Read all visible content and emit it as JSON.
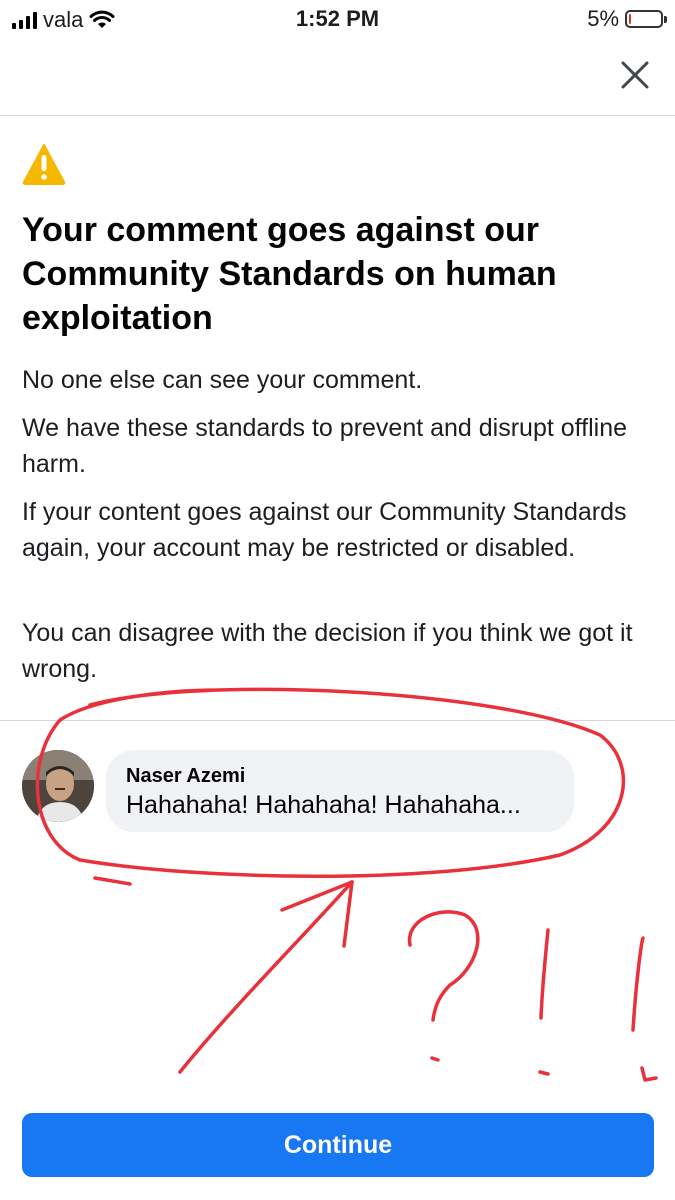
{
  "status_bar": {
    "carrier": "vala",
    "time": "1:52 PM",
    "battery_percent": "5%",
    "battery_level": 0.05,
    "icons": [
      "signal-icon",
      "wifi-icon",
      "battery-icon"
    ]
  },
  "header": {
    "close_icon": "close-icon"
  },
  "notice": {
    "icon": "warning-icon",
    "icon_color": "#f5b800",
    "title": "Your comment goes against our Community Standards on human exploitation",
    "paragraphs": [
      "No one else can see your comment.",
      "We have these standards to prevent and disrupt offline harm.",
      "If your content goes against our Community Standards again, your account may be restricted or disabled.",
      "You can disagree with the decision if you think we got it wrong."
    ]
  },
  "comment": {
    "author": "Naser Azemi",
    "text": "Hahahaha! Hahahaha! Hahahaha..."
  },
  "annotations": {
    "color": "#e8313b",
    "marks": "?!!"
  },
  "footer": {
    "continue_label": "Continue",
    "button_color": "#1877f2"
  }
}
